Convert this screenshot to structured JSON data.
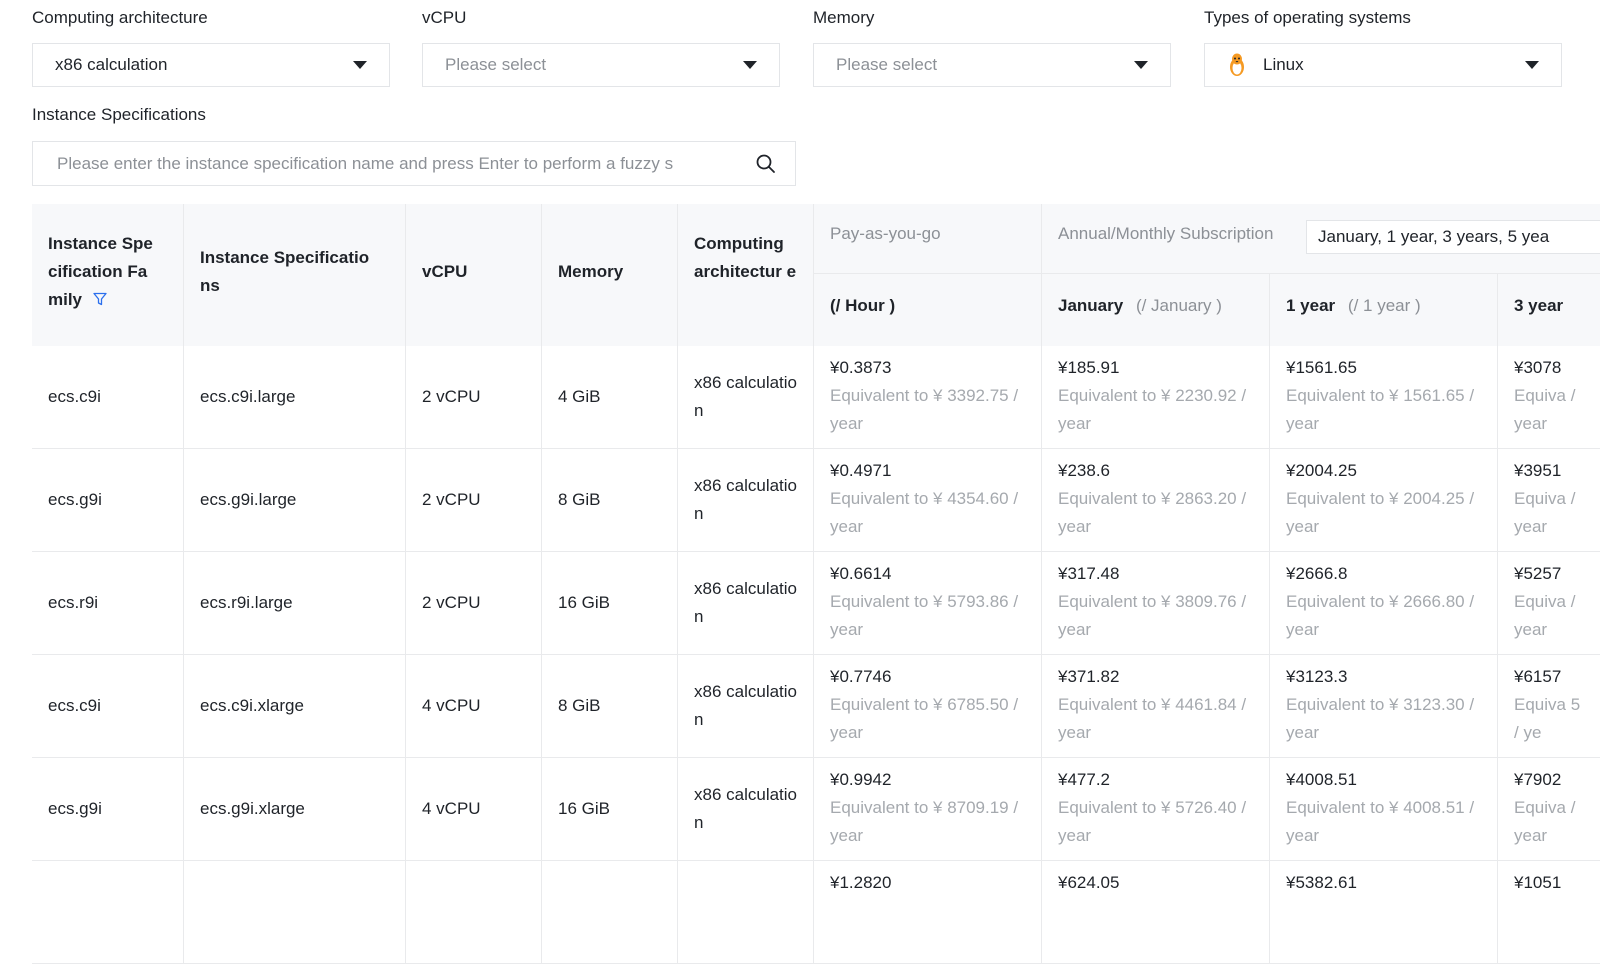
{
  "filters": {
    "arch": {
      "label": "Computing architecture",
      "value": "x86 calculation"
    },
    "vcpu": {
      "label": "vCPU",
      "placeholder": "Please select"
    },
    "memory": {
      "label": "Memory",
      "placeholder": "Please select"
    },
    "os": {
      "label": "Types of operating systems",
      "value": "Linux"
    }
  },
  "spec_search": {
    "label": "Instance Specifications",
    "placeholder": "Please enter the instance specification name and press Enter to perform a fuzzy s"
  },
  "table": {
    "headers": {
      "family": "Instance Spe cification Fa mily",
      "spec": "Instance Specificatio ns",
      "vcpu": "vCPU",
      "memory": "Memory",
      "arch": "Computing architectur e",
      "payg": "Pay-as-you-go",
      "subscription": "Annual/Monthly Subscription",
      "period_select": "January, 1 year, 3 years, 5 yea",
      "hour": "(/ Hour )",
      "jan": "January",
      "jan_unit": "(/ January )",
      "year1": "1 year",
      "year1_unit": "(/ 1 year )",
      "year3": "3 year"
    },
    "rows": [
      {
        "family": "ecs.c9i",
        "spec": "ecs.c9i.large",
        "vcpu": "2 vCPU",
        "memory": "4 GiB",
        "arch": "x86 calculation",
        "hour": "¥0.3873",
        "hour_eq": "Equivalent to ¥ 3392.75 / year",
        "jan": "¥185.91",
        "jan_eq": "Equivalent to ¥ 2230.92 / year",
        "y1": "¥1561.65",
        "y1_eq": "Equivalent to ¥ 1561.65 / year",
        "y3": "¥3078",
        "y3_eq": "Equiva / year"
      },
      {
        "family": "ecs.g9i",
        "spec": "ecs.g9i.large",
        "vcpu": "2 vCPU",
        "memory": "8 GiB",
        "arch": "x86 calculation",
        "hour": "¥0.4971",
        "hour_eq": "Equivalent to ¥ 4354.60 / year",
        "jan": "¥238.6",
        "jan_eq": "Equivalent to ¥ 2863.20 / year",
        "y1": "¥2004.25",
        "y1_eq": "Equivalent to ¥ 2004.25 / year",
        "y3": "¥3951",
        "y3_eq": "Equiva / year"
      },
      {
        "family": "ecs.r9i",
        "spec": "ecs.r9i.large",
        "vcpu": "2 vCPU",
        "memory": "16 GiB",
        "arch": "x86 calculation",
        "hour": "¥0.6614",
        "hour_eq": "Equivalent to ¥ 5793.86 / year",
        "jan": "¥317.48",
        "jan_eq": "Equivalent to ¥ 3809.76 / year",
        "y1": "¥2666.8",
        "y1_eq": "Equivalent to ¥ 2666.80 / year",
        "y3": "¥5257",
        "y3_eq": "Equiva / year"
      },
      {
        "family": "ecs.c9i",
        "spec": "ecs.c9i.xlarge",
        "vcpu": "4 vCPU",
        "memory": "8 GiB",
        "arch": "x86 calculation",
        "hour": "¥0.7746",
        "hour_eq": "Equivalent to ¥ 6785.50 / year",
        "jan": "¥371.82",
        "jan_eq": "Equivalent to ¥ 4461.84 / year",
        "y1": "¥3123.3",
        "y1_eq": "Equivalent to ¥ 3123.30 / year",
        "y3": "¥6157",
        "y3_eq": "Equiva 5 / ye"
      },
      {
        "family": "ecs.g9i",
        "spec": "ecs.g9i.xlarge",
        "vcpu": "4 vCPU",
        "memory": "16 GiB",
        "arch": "x86 calculation",
        "hour": "¥0.9942",
        "hour_eq": "Equivalent to ¥ 8709.19 / year",
        "jan": "¥477.2",
        "jan_eq": "Equivalent to ¥ 5726.40 / year",
        "y1": "¥4008.51",
        "y1_eq": "Equivalent to ¥ 4008.51 / year",
        "y3": "¥7902",
        "y3_eq": "Equiva / year"
      },
      {
        "family": "",
        "spec": "",
        "vcpu": "",
        "memory": "",
        "arch": "",
        "hour": "¥1.2820",
        "hour_eq": "",
        "jan": "¥624.05",
        "jan_eq": "",
        "y1": "¥5382.61",
        "y1_eq": "",
        "y3": "¥1051",
        "y3_eq": ""
      }
    ]
  },
  "colors": {
    "accent": "#2b6fed",
    "muted": "#a5a9ae",
    "header_bg": "#f7f8fa",
    "border": "#e9eaec",
    "penguin": "#f59a23"
  }
}
